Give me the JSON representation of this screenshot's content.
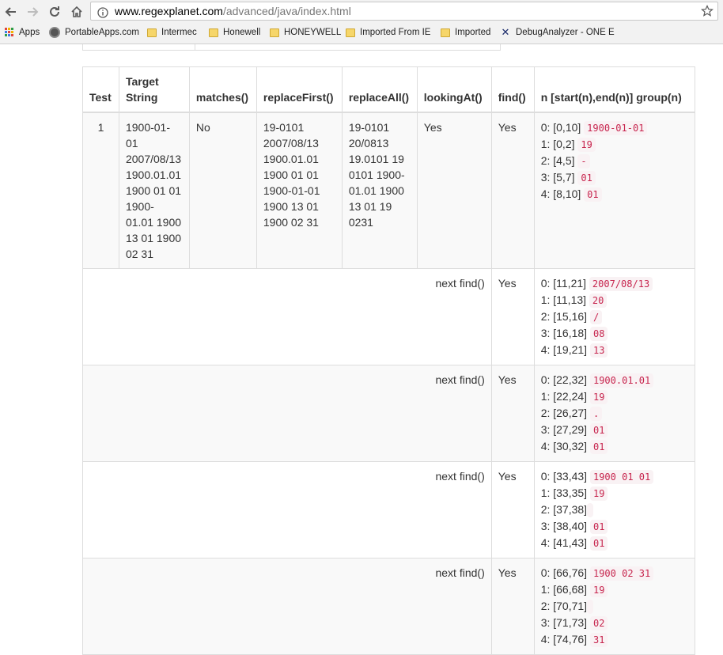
{
  "browser": {
    "url_host": "www.regexplanet.com",
    "url_path": "/advanced/java/index.html",
    "bookmarks": [
      {
        "label": "Apps",
        "icon": "apps-grid-icon"
      },
      {
        "label": "PortableApps.com",
        "icon": "portableapps-icon"
      },
      {
        "label": "Intermec",
        "icon": "folder-icon"
      },
      {
        "label": "Honewell",
        "icon": "folder-icon"
      },
      {
        "label": "HONEYWELL",
        "icon": "folder-icon"
      },
      {
        "label": "Imported From IE",
        "icon": "folder-icon"
      },
      {
        "label": "Imported",
        "icon": "folder-icon"
      },
      {
        "label": "DebugAnalyzer - ONE E",
        "icon": "debuganalyzer-icon"
      }
    ]
  },
  "table": {
    "headers": [
      "Test",
      "Target String",
      "matches()",
      "replaceFirst()",
      "replaceAll()",
      "lookingAt()",
      "find()",
      "n [start(n),end(n)] group(n)"
    ],
    "first_row": {
      "test": "1",
      "target_lines": [
        "1900-01-",
        "01",
        "2007/08/13",
        "1900.01.01",
        "1900 01 01",
        "1900-",
        "01.01 1900",
        "13 01 1900",
        "02 31"
      ],
      "matches": "No",
      "replace_first_lines": [
        "19-0101",
        "2007/08/13",
        "1900.01.01",
        "1900 01 01",
        "1900-01-01",
        "1900 13 01",
        "1900 02 31"
      ],
      "replace_all_lines": [
        "19-0101",
        "20/0813",
        "19.0101 19",
        "0101 1900-",
        "01.01 1900",
        "13 01 19",
        "0231"
      ],
      "looking_at": "Yes",
      "find": "Yes",
      "groups": [
        {
          "idx": "0: [0,10]",
          "val": "1900-01-01"
        },
        {
          "idx": "1: [0,2]",
          "val": "19"
        },
        {
          "idx": "2: [4,5]",
          "val": "-"
        },
        {
          "idx": "3: [5,7]",
          "val": "01"
        },
        {
          "idx": "4: [8,10]",
          "val": "01"
        }
      ]
    },
    "next_rows": [
      {
        "label": "next find()",
        "find": "Yes",
        "groups": [
          {
            "idx": "0: [11,21]",
            "val": "2007/08/13"
          },
          {
            "idx": "1: [11,13]",
            "val": "20"
          },
          {
            "idx": "2: [15,16]",
            "val": "/"
          },
          {
            "idx": "3: [16,18]",
            "val": "08"
          },
          {
            "idx": "4: [19,21]",
            "val": "13"
          }
        ]
      },
      {
        "label": "next find()",
        "find": "Yes",
        "groups": [
          {
            "idx": "0: [22,32]",
            "val": "1900.01.01"
          },
          {
            "idx": "1: [22,24]",
            "val": "19"
          },
          {
            "idx": "2: [26,27]",
            "val": "."
          },
          {
            "idx": "3: [27,29]",
            "val": "01"
          },
          {
            "idx": "4: [30,32]",
            "val": "01"
          }
        ]
      },
      {
        "label": "next find()",
        "find": "Yes",
        "groups": [
          {
            "idx": "0: [33,43]",
            "val": "1900 01 01"
          },
          {
            "idx": "1: [33,35]",
            "val": "19"
          },
          {
            "idx": "2: [37,38]",
            "val": " "
          },
          {
            "idx": "3: [38,40]",
            "val": "01"
          },
          {
            "idx": "4: [41,43]",
            "val": "01"
          }
        ]
      },
      {
        "label": "next find()",
        "find": "Yes",
        "groups": [
          {
            "idx": "0: [66,76]",
            "val": "1900 02 31"
          },
          {
            "idx": "1: [66,68]",
            "val": "19"
          },
          {
            "idx": "2: [70,71]",
            "val": " "
          },
          {
            "idx": "3: [71,73]",
            "val": "02"
          },
          {
            "idx": "4: [74,76]",
            "val": "31"
          }
        ]
      }
    ]
  }
}
